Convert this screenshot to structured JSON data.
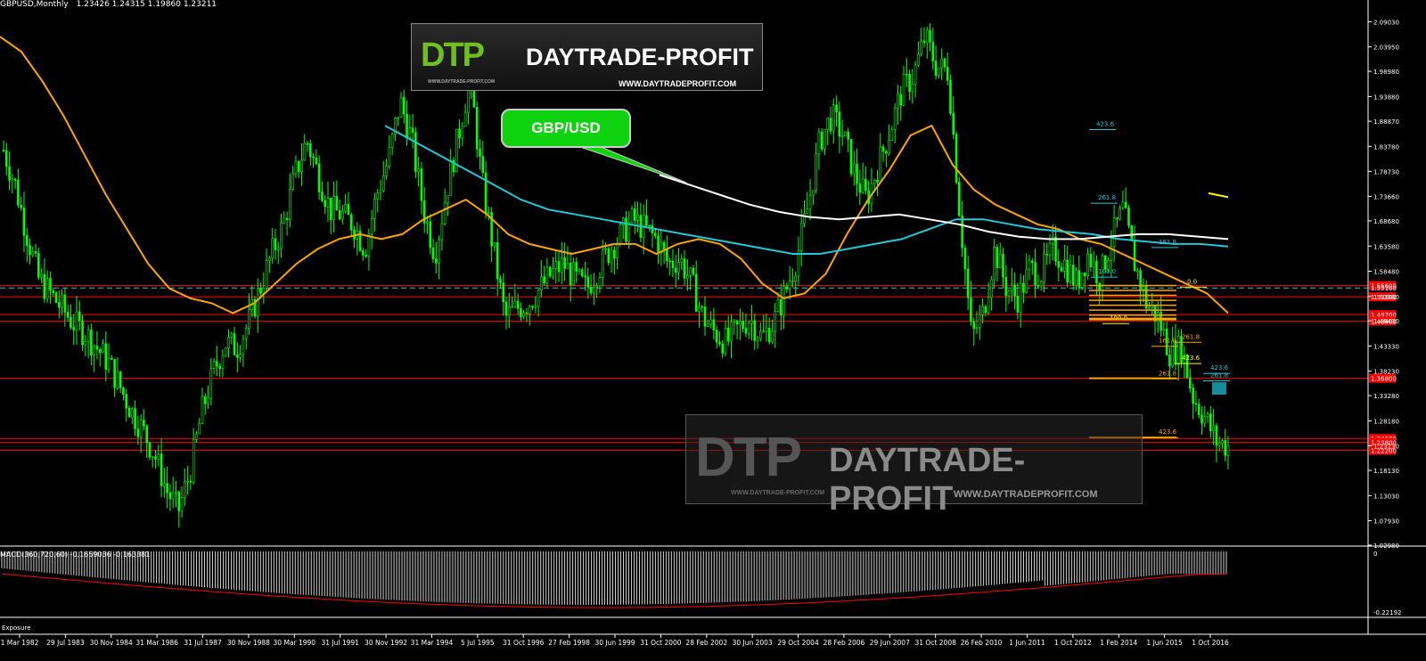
{
  "header": {
    "symbol_label": "GBPUSD,Monthly",
    "ohlc_label": "1.23426 1.24315 1.19860 1.23211"
  },
  "macd_label": "MACD(360,720,60) -0.1659036 -0.163381",
  "exposure_label": "Exposure",
  "callout_text": "GBP/USD",
  "logo_top": {
    "mark": "DTP",
    "name": "DAYTRADE-PROFIT",
    "url": "WWW.DAYTRADEPROFIT.COM",
    "url_small": "WWW.DAYTRADE-PROFIT.COM"
  },
  "logo_watermark": {
    "mark": "DTP",
    "name": "DAYTRADE-PROFIT",
    "url": "WWW.DAYTRADEPROFIT.COM",
    "url_small": "WWW.DAYTRADE-PROFIT.COM"
  },
  "colors": {
    "background": "#000000",
    "candle": "#00ff00",
    "ma_orange": "#ffa500",
    "ma_cyan": "#22c7d8",
    "ma_white": "#ffffff",
    "level_red": "#ff0000",
    "price_dashed": "#22c7d8",
    "fib_orange": "#ffa500",
    "fib_cyan": "#22c7d8",
    "fib_yellow": "#ffff00"
  },
  "chart_data": {
    "type": "candlestick",
    "title": "GBPUSD,Monthly",
    "x_tick_labels": [
      "1 Mar 1982",
      "29 Jul 1983",
      "30 Nov 1984",
      "31 Mar 1986",
      "31 Jul 1987",
      "30 Nov 1988",
      "30 Mar 1990",
      "31 Jul 1991",
      "30 Nov 1992",
      "31 Mar 1994",
      "5 Jul 1995",
      "31 Oct 1996",
      "27 Feb 1998",
      "30 Jun 1999",
      "31 Oct 2000",
      "28 Feb 2002",
      "30 Jun 2003",
      "29 Oct 2004",
      "28 Feb 2006",
      "29 Jun 2007",
      "31 Oct 2008",
      "26 Feb 2010",
      "1 Jun 2011",
      "1 Oct 2012",
      "1 Feb 2014",
      "1 Jun 2015",
      "1 Oct 2016"
    ],
    "y_tick_labels": [
      "2.09030",
      "2.03950",
      "1.98980",
      "1.93880",
      "1.88870",
      "1.83780",
      "1.78730",
      "1.73660",
      "1.68680",
      "1.63580",
      "1.58480",
      "1.53380",
      "1.48430",
      "1.43330",
      "1.38230",
      "1.33280",
      "1.28180",
      "1.23130",
      "1.18130",
      "1.13030",
      "1.07930",
      "1.02980"
    ],
    "ylim": [
      1.0298,
      2.12
    ],
    "current_price": 1.23211,
    "red_levels": [
      {
        "price": 1.556,
        "label": "1.55600"
      },
      {
        "price": 1.533,
        "label": "1.53300"
      },
      {
        "price": 1.497,
        "label": "1.49700"
      },
      {
        "price": 1.484,
        "label": "1.48400"
      },
      {
        "price": 1.368,
        "label": "1.36800"
      },
      {
        "price": 1.246,
        "label": "1.24600"
      },
      {
        "price": 1.238,
        "label": "1.23800"
      },
      {
        "price": 1.222,
        "label": "1.22200"
      }
    ],
    "dashed_level": {
      "price": 1.551,
      "label": "1.55100"
    },
    "series": [
      {
        "name": "GBPUSD",
        "type": "candlestick",
        "close": [
          1.83,
          1.76,
          1.66,
          1.57,
          1.54,
          1.51,
          1.48,
          1.46,
          1.43,
          1.4,
          1.35,
          1.3,
          1.26,
          1.21,
          1.14,
          1.1,
          1.18,
          1.3,
          1.38,
          1.44,
          1.43,
          1.48,
          1.55,
          1.62,
          1.68,
          1.78,
          1.85,
          1.78,
          1.71,
          1.7,
          1.68,
          1.63,
          1.74,
          1.81,
          1.93,
          1.85,
          1.71,
          1.62,
          1.75,
          1.86,
          1.98,
          1.77,
          1.63,
          1.49,
          1.51,
          1.52,
          1.55,
          1.58,
          1.6,
          1.57,
          1.55,
          1.59,
          1.63,
          1.66,
          1.69,
          1.67,
          1.65,
          1.6,
          1.61,
          1.56,
          1.49,
          1.46,
          1.44,
          1.47,
          1.49,
          1.45,
          1.48,
          1.54,
          1.61,
          1.72,
          1.85,
          1.9,
          1.86,
          1.78,
          1.73,
          1.8,
          1.87,
          1.95,
          1.98,
          2.06,
          2.0,
          1.99,
          1.7,
          1.45,
          1.5,
          1.63,
          1.55,
          1.53,
          1.59,
          1.58,
          1.63,
          1.6,
          1.56,
          1.62,
          1.57,
          1.65,
          1.71,
          1.6,
          1.52,
          1.49,
          1.42,
          1.43,
          1.33,
          1.29,
          1.24,
          1.23
        ]
      }
    ],
    "moving_averages": [
      {
        "name": "MA orange",
        "values": [
          2.06,
          2.03,
          1.97,
          1.9,
          1.82,
          1.74,
          1.67,
          1.6,
          1.55,
          1.53,
          1.52,
          1.5,
          1.52,
          1.56,
          1.6,
          1.63,
          1.65,
          1.66,
          1.65,
          1.66,
          1.69,
          1.71,
          1.73,
          1.7,
          1.66,
          1.64,
          1.63,
          1.62,
          1.63,
          1.64,
          1.64,
          1.62,
          1.64,
          1.65,
          1.64,
          1.61,
          1.56,
          1.53,
          1.54,
          1.58,
          1.66,
          1.73,
          1.79,
          1.86,
          1.88,
          1.8,
          1.75,
          1.72,
          1.7,
          1.68,
          1.67,
          1.65,
          1.64,
          1.62,
          1.6,
          1.58,
          1.56,
          1.54,
          1.5
        ]
      },
      {
        "name": "MA cyan",
        "values": [
          1.88,
          1.85,
          1.82,
          1.79,
          1.76,
          1.73,
          1.71,
          1.7,
          1.69,
          1.68,
          1.67,
          1.66,
          1.65,
          1.64,
          1.63,
          1.62,
          1.62,
          1.63,
          1.64,
          1.65,
          1.67,
          1.69,
          1.69,
          1.68,
          1.67,
          1.665,
          1.66,
          1.65,
          1.645,
          1.64,
          1.64,
          1.635
        ]
      },
      {
        "name": "MA white",
        "values": [
          1.78,
          1.76,
          1.74,
          1.72,
          1.705,
          1.695,
          1.69,
          1.695,
          1.7,
          1.69,
          1.68,
          1.665,
          1.655,
          1.65,
          1.65,
          1.655,
          1.66,
          1.66,
          1.655,
          1.65
        ]
      }
    ],
    "fib_labels": [
      {
        "label": "423.6",
        "price": 1.879,
        "color": "cyan"
      },
      {
        "label": "261.8",
        "price": 1.73,
        "color": "cyan"
      },
      {
        "label": "161.8",
        "price": 1.64,
        "color": "cyan"
      },
      {
        "label": "100.0",
        "price": 1.58,
        "color": "cyan"
      },
      {
        "label": "100.0",
        "price": 1.486,
        "color": "yellow"
      },
      {
        "label": "161.8",
        "price": 1.44,
        "color": "orange"
      },
      {
        "label": "261.8",
        "price": 1.448,
        "color": "orange"
      },
      {
        "label": "423.6",
        "price": 1.405,
        "color": "yellow"
      },
      {
        "label": "261.8",
        "price": 1.374,
        "color": "orange"
      },
      {
        "label": "423.6",
        "price": 1.385,
        "color": "cyan"
      },
      {
        "label": "261.8",
        "price": 1.37,
        "color": "cyan"
      },
      {
        "label": "423.6",
        "price": 1.255,
        "color": "orange"
      },
      {
        "label": "0.0",
        "price": 1.56,
        "color": "yellow"
      }
    ],
    "macd": {
      "name": "MACD(360,720,60)",
      "main": -0.1659036,
      "signal": -0.163381,
      "ylim": [
        -0.22192,
        0.0
      ]
    },
    "macd_y_tick_labels": [
      "0",
      "-0.22192"
    ],
    "grid": false
  }
}
